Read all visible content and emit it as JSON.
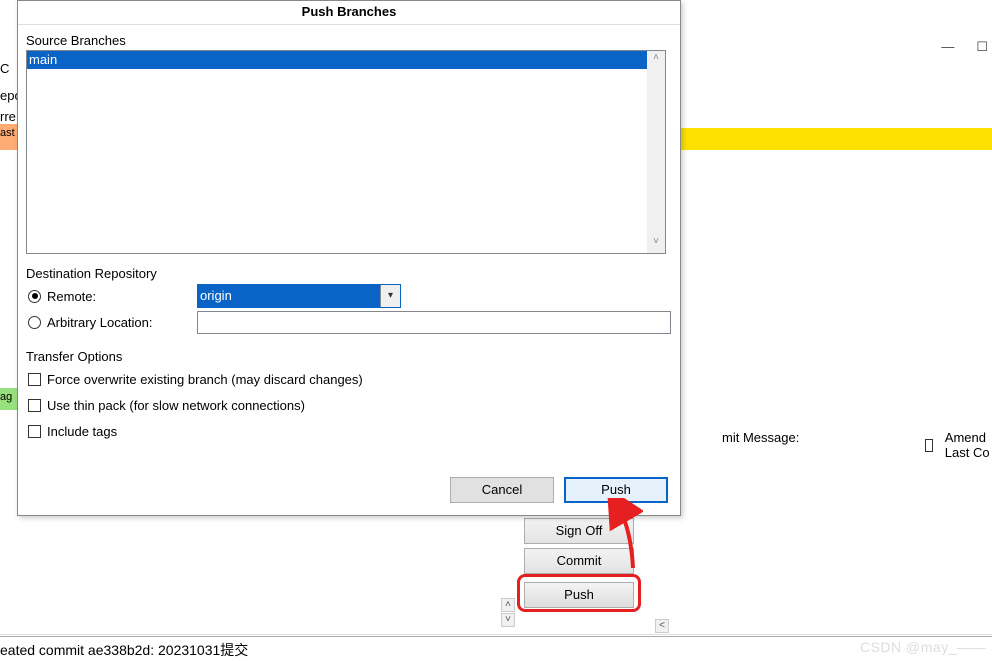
{
  "dialog": {
    "title": "Push Branches",
    "source_label": "Source Branches",
    "source_items": {
      "0": "main"
    },
    "dest_label": "Destination Repository",
    "remote_label": "Remote:",
    "remote_value": "origin",
    "arbitrary_label": "Arbitrary Location:",
    "transfer_label": "Transfer Options",
    "force_label": "Force overwrite existing branch (may discard changes)",
    "thinpack_label": "Use thin pack (for slow network connections)",
    "include_tags_label": "Include tags",
    "cancel": "Cancel",
    "push": "Push"
  },
  "bg": {
    "left": {
      "a": "C",
      "b": "epo",
      "c": "rre",
      "d": "ast",
      "e": "ag"
    },
    "commit_msg_label": "mit Message:",
    "amend_label": "Amend Last Co",
    "signoff": "Sign Off",
    "commit": "Commit",
    "push": "Push",
    "status": "eated commit ae338b2d: 20231031提交",
    "watermark": "CSDN @may_——"
  }
}
